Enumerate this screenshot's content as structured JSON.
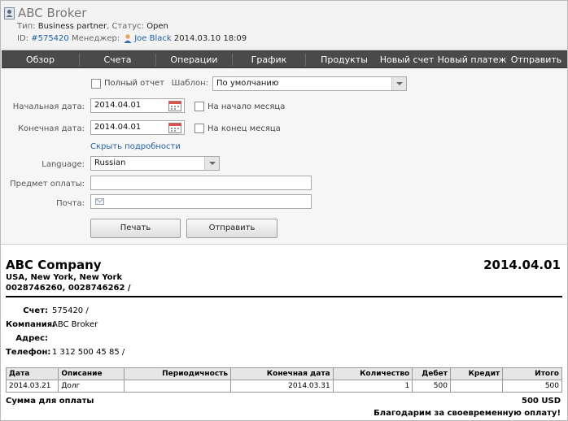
{
  "header": {
    "title": "ABC Broker",
    "type_label": "Тип:",
    "type_value": "Business partner",
    "status_label": "Статус:",
    "status_value": "Open",
    "id_label": "ID:",
    "id_value": "#575420",
    "manager_label": "Менеджер:",
    "manager_value": "Joe Black",
    "datetime": "2014.03.10 18:09"
  },
  "nav": {
    "items": [
      "Обзор",
      "Счета",
      "Операции",
      "График",
      "Продукты",
      "Новый счет",
      "Новый платеж",
      "Отправить"
    ]
  },
  "form": {
    "full_report_label": "Полный отчет",
    "template_label": "Шаблон:",
    "template_value": "По умолчанию",
    "start_date_label": "Начальная дата:",
    "start_date_value": "2014.04.01",
    "month_start_label": "На начало месяца",
    "end_date_label": "Конечная дата:",
    "end_date_value": "2014.04.01",
    "month_end_label": "На конец месяца",
    "hide_details_link": "Скрыть подробности",
    "language_label": "Language:",
    "language_value": "Russian",
    "subject_label": "Предмет оплаты:",
    "subject_value": "",
    "email_label": "Почта:",
    "email_value": "",
    "print_button": "Печать",
    "send_button": "Отправить"
  },
  "invoice": {
    "company": "ABC Company",
    "date": "2014.04.01",
    "address": "USA, New York, New York",
    "phones": "0028746260, 0028746262 /",
    "account_label": "Счет:",
    "account_value": "575420 /",
    "company_label": "Компания:",
    "company_value": "ABC Broker",
    "address_label": "Адрес:",
    "address_value": "",
    "phone_label": "Телефон:",
    "phone_value": "1 312 500 45 85 /",
    "table": {
      "headers": [
        "Дата",
        "Описание",
        "Периодичность",
        "Конечная дата",
        "Количество",
        "Дебет",
        "Кредит",
        "Итого"
      ],
      "rows": [
        [
          "2014.03.21",
          "Долг",
          "",
          "2014.03.31",
          "1",
          "500",
          "",
          "500"
        ]
      ]
    },
    "sum_label": "Сумма для оплаты",
    "sum_value": "500 USD",
    "thanks": "Благодарим за своевременную оплату!"
  },
  "colors": {
    "nav_bg": "#4a4a4a",
    "link": "#1f5fa6",
    "header_bg": "#f3f3f3"
  }
}
